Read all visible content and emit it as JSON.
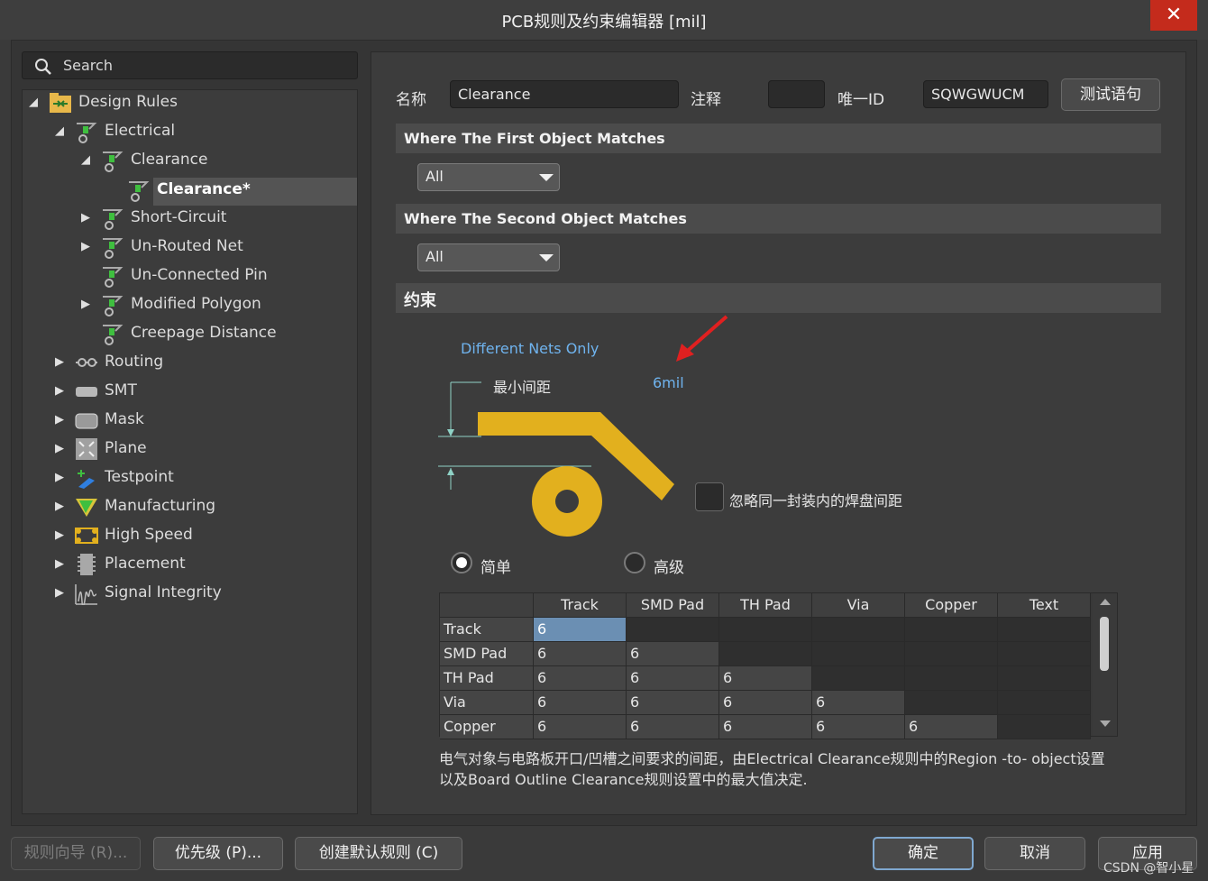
{
  "window": {
    "title": "PCB规则及约束编辑器 [mil]",
    "close": "✕"
  },
  "search": {
    "placeholder": "Search"
  },
  "tree": [
    {
      "label": "Design Rules",
      "expand": "◢"
    },
    {
      "label": "Electrical",
      "expand": "◢"
    },
    {
      "label": "Clearance",
      "expand": "◢"
    },
    {
      "label": "Clearance*",
      "expand": ""
    },
    {
      "label": "Short-Circuit",
      "expand": "▶"
    },
    {
      "label": "Un-Routed Net",
      "expand": "▶"
    },
    {
      "label": "Un-Connected Pin",
      "expand": ""
    },
    {
      "label": "Modified Polygon",
      "expand": "▶"
    },
    {
      "label": "Creepage Distance",
      "expand": ""
    },
    {
      "label": "Routing",
      "expand": "▶"
    },
    {
      "label": "SMT",
      "expand": "▶"
    },
    {
      "label": "Mask",
      "expand": "▶"
    },
    {
      "label": "Plane",
      "expand": "▶"
    },
    {
      "label": "Testpoint",
      "expand": "▶"
    },
    {
      "label": "Manufacturing",
      "expand": "▶"
    },
    {
      "label": "High Speed",
      "expand": "▶"
    },
    {
      "label": "Placement",
      "expand": "▶"
    },
    {
      "label": "Signal Integrity",
      "expand": "▶"
    }
  ],
  "rule": {
    "name_label": "名称",
    "name_value": "Clearance",
    "comment_label": "注释",
    "comment_value": "",
    "uid_label": "唯一ID",
    "uid_value": "SQWGWUCM",
    "test_button": "测试语句"
  },
  "first_match": {
    "header": "Where The First Object Matches",
    "value": "All"
  },
  "second_match": {
    "header": "Where The Second Object Matches",
    "value": "All"
  },
  "constraints": {
    "header": "约束",
    "net_scope": "Different Nets Only",
    "min_label": "最小间距",
    "min_value": "6mil",
    "ignore_label": "忽略同一封装内的焊盘间距",
    "mode_simple": "简单",
    "mode_advanced": "高级"
  },
  "grid": {
    "columns": [
      "Track",
      "SMD Pad",
      "TH Pad",
      "Via",
      "Copper",
      "Text"
    ],
    "rows": [
      {
        "name": "Track",
        "values": [
          "6",
          "",
          "",
          "",
          "",
          ""
        ]
      },
      {
        "name": "SMD Pad",
        "values": [
          "6",
          "6",
          "",
          "",
          "",
          ""
        ]
      },
      {
        "name": "TH Pad",
        "values": [
          "6",
          "6",
          "6",
          "",
          "",
          ""
        ]
      },
      {
        "name": "Via",
        "values": [
          "6",
          "6",
          "6",
          "6",
          "",
          ""
        ]
      },
      {
        "name": "Copper",
        "values": [
          "6",
          "6",
          "6",
          "6",
          "6",
          ""
        ]
      }
    ]
  },
  "note": {
    "line1": "电气对象与电路板开口/凹槽之间要求的间距，由Electrical Clearance规则中的Region -to- object设置",
    "line2": "以及Board Outline Clearance规则设置中的最大值决定."
  },
  "footer": {
    "wizard": "规则向导 (R)...",
    "priority": "优先级 (P)...",
    "defaults": "创建默认规则 (C)",
    "ok": "确定",
    "cancel": "取消",
    "apply": "应用",
    "watermark": "CSDN @智小星"
  },
  "colors": {
    "accent_link": "#6fb3ee",
    "copper": "#e2b01e",
    "selection": "#6b8fb3",
    "arrow": "#e02020"
  }
}
